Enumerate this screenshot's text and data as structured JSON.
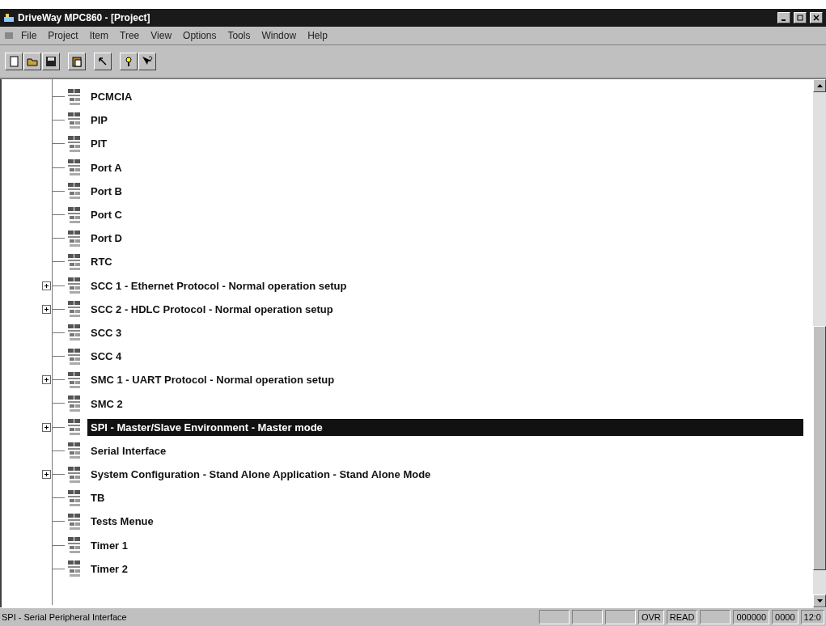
{
  "window": {
    "title": "DriveWay MPC860 - [Project]"
  },
  "menu": [
    "File",
    "Project",
    "Item",
    "Tree",
    "View",
    "Options",
    "Tools",
    "Window",
    "Help"
  ],
  "tree": [
    {
      "label": "PCMCIA",
      "kind": "leaf",
      "selected": false
    },
    {
      "label": "PIP",
      "kind": "leaf",
      "selected": false
    },
    {
      "label": "PIT",
      "kind": "leaf",
      "selected": false
    },
    {
      "label": "Port A",
      "kind": "leaf",
      "selected": false
    },
    {
      "label": "Port B",
      "kind": "leaf",
      "selected": false
    },
    {
      "label": "Port C",
      "kind": "leaf",
      "selected": false
    },
    {
      "label": "Port D",
      "kind": "leaf",
      "selected": false
    },
    {
      "label": "RTC",
      "kind": "leaf",
      "selected": false
    },
    {
      "label": "SCC 1 - Ethernet Protocol - Normal operation setup",
      "kind": "collapsed",
      "selected": false
    },
    {
      "label": "SCC 2 - HDLC Protocol - Normal operation setup",
      "kind": "collapsed",
      "selected": false
    },
    {
      "label": "SCC 3",
      "kind": "leaf",
      "selected": false
    },
    {
      "label": "SCC 4",
      "kind": "leaf",
      "selected": false
    },
    {
      "label": "SMC 1 - UART Protocol - Normal operation setup",
      "kind": "collapsed",
      "selected": false
    },
    {
      "label": "SMC 2",
      "kind": "leaf",
      "selected": false
    },
    {
      "label": "SPI - Master/Slave Environment - Master mode",
      "kind": "collapsed",
      "selected": true
    },
    {
      "label": "Serial Interface",
      "kind": "leaf",
      "selected": false
    },
    {
      "label": "System Configuration - Stand Alone Application - Stand Alone Mode",
      "kind": "collapsed",
      "selected": false
    },
    {
      "label": "TB",
      "kind": "leaf",
      "selected": false
    },
    {
      "label": "Tests Menue",
      "kind": "leaf",
      "selected": false
    },
    {
      "label": "Timer 1",
      "kind": "leaf",
      "selected": false
    },
    {
      "label": "Timer 2",
      "kind": "leaf",
      "selected": false
    }
  ],
  "status_bar": {
    "message": "SPI - Serial Peripheral Interface",
    "panels": [
      "OVR",
      "READ",
      "000000",
      "0000",
      "12:0"
    ]
  }
}
